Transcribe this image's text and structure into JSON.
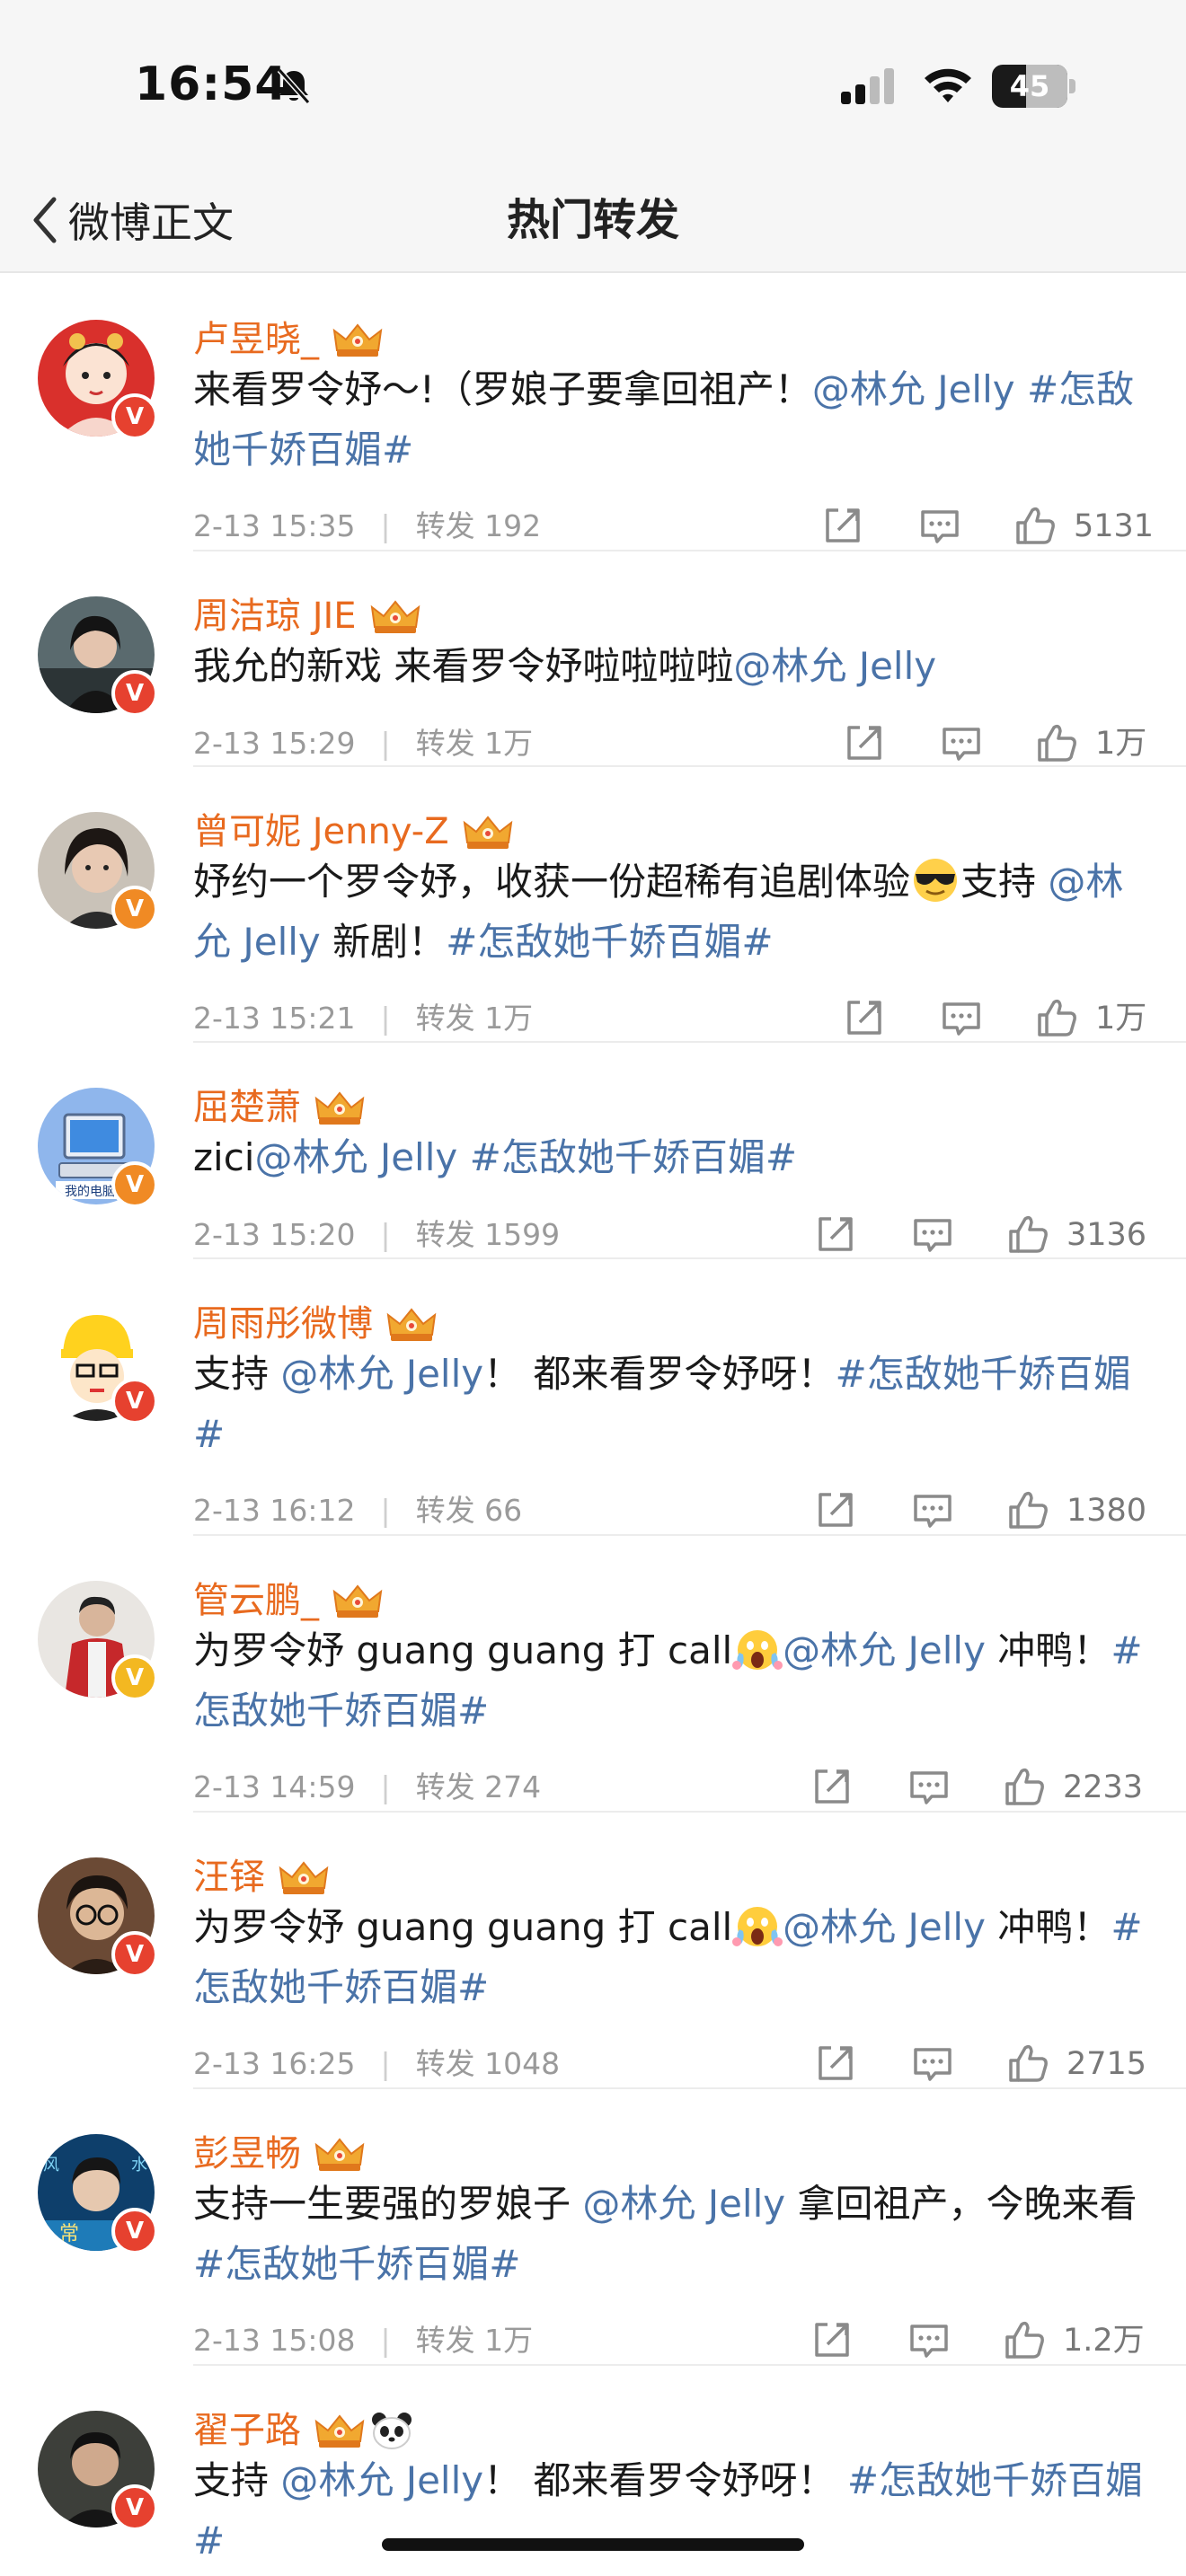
{
  "status": {
    "time": "16:54",
    "battery": "45",
    "battery_level": 0.45
  },
  "nav": {
    "back_label": "微博正文",
    "title": "热门转发"
  },
  "colors": {
    "name": "#e86a1f",
    "link": "#4a73a8",
    "meta": "#9a9a9a",
    "badge_red": "#e6412f",
    "badge_orange": "#f08a24",
    "badge_gold": "#f3b821"
  },
  "items": [
    {
      "name": "卢昱晓_",
      "badge": "red",
      "segments": [
        {
          "t": "text",
          "v": "来看罗令妤～!（罗娘子要拿回祖产！"
        },
        {
          "t": "mention",
          "v": "@林允 Jelly"
        },
        {
          "t": "text",
          "v": " "
        },
        {
          "t": "topic",
          "v": "#怎敌她千娇百媚#"
        }
      ],
      "time": "2-13 15:35",
      "repost_label": "转发 192",
      "likes": "5131"
    },
    {
      "name": "周洁琼 JIE",
      "badge": "red",
      "segments": [
        {
          "t": "text",
          "v": "我允的新戏 来看罗令妤啦啦啦啦"
        },
        {
          "t": "mention",
          "v": "@林允 Jelly"
        }
      ],
      "time": "2-13 15:29",
      "repost_label": "转发 1万",
      "likes": "1万"
    },
    {
      "name": "曾可妮 Jenny-Z",
      "badge": "orange",
      "segments": [
        {
          "t": "text",
          "v": "妤约一个罗令妤，收获一份超稀有追剧体验"
        },
        {
          "t": "emoji",
          "v": "sunglasses-emoji"
        },
        {
          "t": "text",
          "v": "支持 "
        },
        {
          "t": "mention",
          "v": "@林允 Jelly"
        },
        {
          "t": "text",
          "v": " 新剧！"
        },
        {
          "t": "topic",
          "v": "#怎敌她千娇百媚#"
        }
      ],
      "time": "2-13 15:21",
      "repost_label": "转发 1万",
      "likes": "1万"
    },
    {
      "name": "屈楚萧",
      "badge": "orange",
      "segments": [
        {
          "t": "text",
          "v": "zici"
        },
        {
          "t": "mention",
          "v": "@林允 Jelly"
        },
        {
          "t": "text",
          "v": " "
        },
        {
          "t": "topic",
          "v": "#怎敌她千娇百媚#"
        }
      ],
      "time": "2-13 15:20",
      "repost_label": "转发 1599",
      "likes": "3136"
    },
    {
      "name": "周雨彤微博",
      "badge": "red",
      "segments": [
        {
          "t": "text",
          "v": "支持 "
        },
        {
          "t": "mention",
          "v": "@林允 Jelly"
        },
        {
          "t": "text",
          "v": "！ 都来看罗令妤呀！"
        },
        {
          "t": "topic",
          "v": "#怎敌她千娇百媚#"
        }
      ],
      "time": "2-13 16:12",
      "repost_label": "转发 66",
      "likes": "1380"
    },
    {
      "name": "管云鹏_",
      "badge": "gold",
      "segments": [
        {
          "t": "text",
          "v": "为罗令妤 guang guang 打 call"
        },
        {
          "t": "emoji",
          "v": "scream-emoji"
        },
        {
          "t": "mention",
          "v": "@林允 Jelly"
        },
        {
          "t": "text",
          "v": " 冲鸭！"
        },
        {
          "t": "topic",
          "v": "#怎敌她千娇百媚#"
        }
      ],
      "time": "2-13 14:59",
      "repost_label": "转发 274",
      "likes": "2233"
    },
    {
      "name": "汪铎",
      "badge": "red",
      "segments": [
        {
          "t": "text",
          "v": "为罗令妤 guang guang 打 call"
        },
        {
          "t": "emoji",
          "v": "scream-emoji"
        },
        {
          "t": "mention",
          "v": "@林允 Jelly"
        },
        {
          "t": "text",
          "v": " 冲鸭！"
        },
        {
          "t": "topic",
          "v": "#怎敌她千娇百媚#"
        }
      ],
      "time": "2-13 16:25",
      "repost_label": "转发 1048",
      "likes": "2715"
    },
    {
      "name": "彭昱畅",
      "badge": "red",
      "segments": [
        {
          "t": "text",
          "v": "支持一生要强的罗娘子 "
        },
        {
          "t": "mention",
          "v": "@林允 Jelly"
        },
        {
          "t": "text",
          "v": " 拿回祖产，今晚来看 "
        },
        {
          "t": "topic",
          "v": "#怎敌她千娇百媚#"
        }
      ],
      "time": "2-13 15:08",
      "repost_label": "转发 1万",
      "likes": "1.2万"
    },
    {
      "name": "翟子路",
      "badge": "red",
      "extra_panda": true,
      "segments": [
        {
          "t": "text",
          "v": "支持 "
        },
        {
          "t": "mention",
          "v": "@林允 Jelly"
        },
        {
          "t": "text",
          "v": "！ 都来看罗令妤呀！ "
        },
        {
          "t": "topic",
          "v": "#怎敌她千娇百媚#"
        }
      ],
      "time": "",
      "repost_label": "",
      "likes": ""
    }
  ]
}
